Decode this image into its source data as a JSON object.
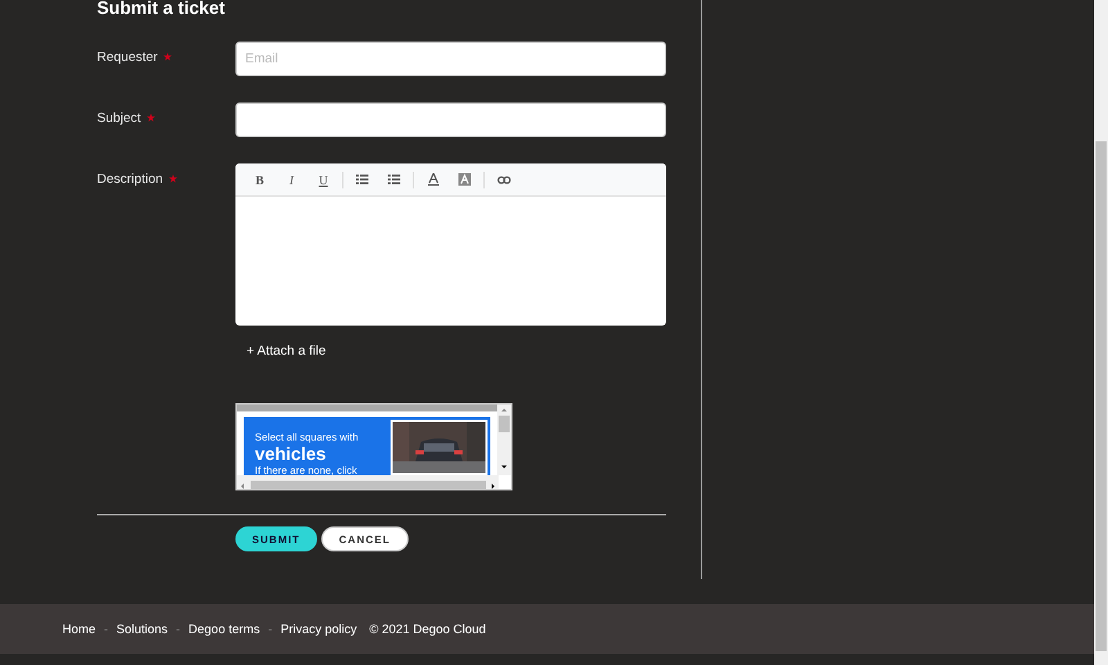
{
  "form": {
    "title": "Submit a ticket",
    "fields": [
      {
        "kind": "input",
        "label": "Requester",
        "required": true,
        "placeholder": "Email"
      },
      {
        "kind": "input",
        "label": "Subject",
        "required": true
      },
      {
        "kind": "editor",
        "label": "Description",
        "required": true
      }
    ],
    "toolbar": [
      {
        "kind": "bold",
        "label": "B"
      },
      {
        "kind": "italic",
        "label": "I"
      },
      {
        "kind": "underline",
        "label": "U"
      },
      {
        "kind": "separator"
      },
      {
        "kind": "bullets"
      },
      {
        "kind": "numbers"
      },
      {
        "kind": "separator"
      },
      {
        "kind": "font-color"
      },
      {
        "kind": "highlight"
      },
      {
        "kind": "separator"
      },
      {
        "kind": "link"
      }
    ],
    "attach": "+ Attach a file",
    "captcha": {
      "line_1": "Select all squares with",
      "keyword": "vehicles",
      "line_2": "If there are none, click"
    },
    "buttons": [
      {
        "kind": "primary",
        "label": "SUBMIT"
      },
      {
        "kind": "secondary",
        "label": "CANCEL"
      }
    ]
  },
  "footer": {
    "items": [
      {
        "kind": "link",
        "text": "Home"
      },
      {
        "kind": "separator",
        "text": "-"
      },
      {
        "kind": "link",
        "text": "Solutions"
      },
      {
        "kind": "separator",
        "text": "-"
      },
      {
        "kind": "link",
        "text": "Degoo terms"
      },
      {
        "kind": "separator",
        "text": "-"
      },
      {
        "kind": "link",
        "text": "Privacy policy"
      },
      {
        "kind": "copyright",
        "text": "© 2021 Degoo Cloud"
      }
    ]
  }
}
